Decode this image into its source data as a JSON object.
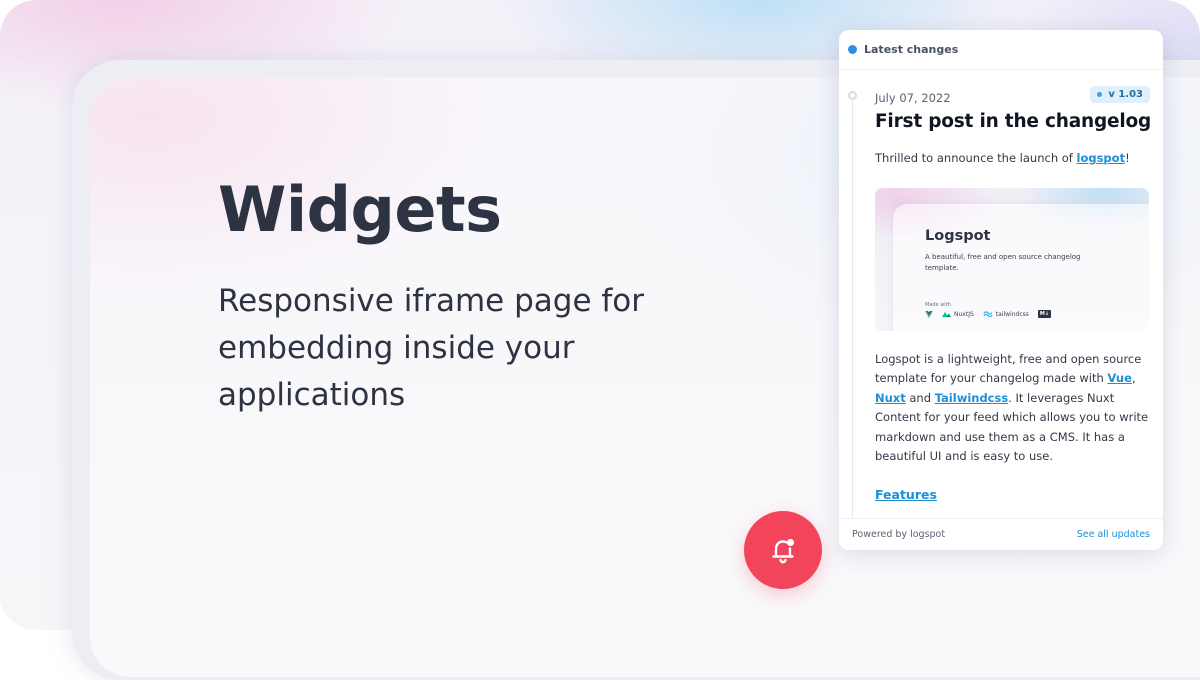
{
  "hero": {
    "title": "Widgets",
    "subtitle": "Responsive iframe page for embedding inside your applications"
  },
  "widget": {
    "header_title": "Latest changes",
    "post": {
      "date": "July 07, 2022",
      "version": "v 1.03",
      "title": "First post in the changelog",
      "intro_prefix": "Thrilled to announce the launch of ",
      "intro_link": "logspot",
      "intro_suffix": "!",
      "image": {
        "title": "Logspot",
        "description": "A beautiful, free and open source changelog template.",
        "made_with": "Made with",
        "logos": [
          "NuxtJS",
          "tailwindcss",
          "M↓"
        ]
      },
      "body_1": "Logspot is a lightweight, free and open source template for your changelog made with ",
      "link_vue": "Vue",
      "comma": ", ",
      "link_nuxt": "Nuxt",
      "and": " and ",
      "link_tailwind": "Tailwindcss",
      "body_2": ". It leverages Nuxt Content for your feed which allows you to write markdown and use them as a CMS. It has a beautiful UI and is easy to use.",
      "features_link": "Features"
    },
    "footer": {
      "powered_by": "Powered by logspot",
      "see_all": "See all updates"
    }
  },
  "colors": {
    "accent": "#f2455c",
    "link": "#1b8fd8",
    "text": "#2d3343"
  },
  "icons": {
    "bell": "bell-notification-icon",
    "status": "live-dot-icon"
  }
}
